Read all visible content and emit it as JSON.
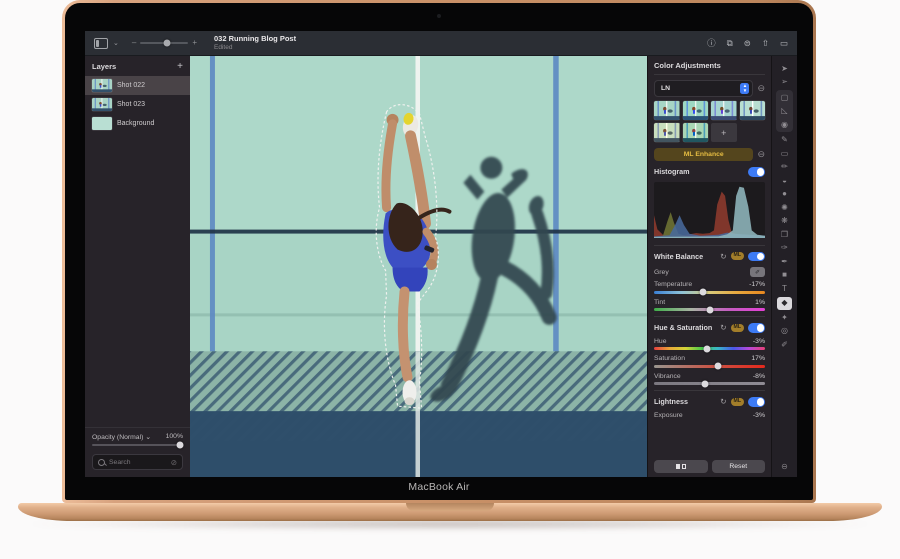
{
  "device": {
    "label": "MacBook Air"
  },
  "icons": {
    "chevron_down": "⌄",
    "reset": "↻",
    "remove": "⊖",
    "dropper": "✐",
    "stepper_up": "▲",
    "stepper_down": "▼",
    "search_clear": "⊘"
  },
  "toolbar": {
    "title": "032 Running Blog Post",
    "status": "Edited",
    "zoom": {
      "minus": "–",
      "plus": "+",
      "level": 55
    },
    "right_icons": [
      {
        "name": "info-icon",
        "glyph": "ⓘ"
      },
      {
        "name": "crop-icon",
        "glyph": "⧉"
      },
      {
        "name": "more-options-icon",
        "glyph": "⊜"
      },
      {
        "name": "share-icon",
        "glyph": "⇧"
      },
      {
        "name": "canvas-icon",
        "glyph": "▭"
      }
    ]
  },
  "layers_panel": {
    "title": "Layers",
    "add_label": "+",
    "items": [
      {
        "label": "Shot 022",
        "selected": true,
        "thumb": "photo"
      },
      {
        "label": "Shot 023",
        "selected": false,
        "thumb": "photo"
      },
      {
        "label": "Background",
        "selected": false,
        "thumb": "plain"
      }
    ],
    "opacity": {
      "label": "Opacity (Normal) ⌄",
      "value": "100%",
      "percent": 97
    },
    "search": {
      "placeholder": "Search"
    }
  },
  "adjustments_panel": {
    "title": "Color Adjustments",
    "preset_select": {
      "value": "LN"
    },
    "presets": {
      "add_label": "+",
      "variants": [
        "saturate(1.05)",
        "saturate(1.35)",
        "hue-rotate(18deg) saturate(1.1)",
        "contrast(1.15) saturate(.78)",
        "sepia(.35) saturate(1.15)",
        "hue-rotate(-25deg) saturate(1.2)"
      ]
    },
    "ml_enhance_label": "ML Enhance",
    "histogram": {
      "label": "Histogram",
      "enabled": true,
      "series": [
        {
          "color": "#8e3a2e",
          "heights": [
            [
              0,
              42
            ],
            [
              3,
              16
            ],
            [
              8,
              6
            ],
            [
              14,
              5
            ],
            [
              20,
              6
            ],
            [
              26,
              5
            ],
            [
              32,
              7
            ],
            [
              38,
              9
            ],
            [
              44,
              8
            ],
            [
              50,
              9
            ],
            [
              54,
              14
            ],
            [
              57,
              62
            ],
            [
              61,
              86
            ],
            [
              64,
              78
            ],
            [
              67,
              34
            ],
            [
              70,
              10
            ],
            [
              76,
              6
            ],
            [
              84,
              5
            ],
            [
              92,
              4
            ],
            [
              100,
              3
            ]
          ]
        },
        {
          "color": "#6f7434",
          "heights": [
            [
              0,
              2
            ],
            [
              8,
              4
            ],
            [
              12,
              30
            ],
            [
              15,
              48
            ],
            [
              18,
              28
            ],
            [
              22,
              8
            ],
            [
              30,
              3
            ],
            [
              60,
              2
            ],
            [
              100,
              2
            ]
          ]
        },
        {
          "color": "#48699b",
          "heights": [
            [
              0,
              3
            ],
            [
              14,
              5
            ],
            [
              19,
              24
            ],
            [
              23,
              42
            ],
            [
              27,
              24
            ],
            [
              32,
              8
            ],
            [
              42,
              4
            ],
            [
              58,
              6
            ],
            [
              66,
              10
            ],
            [
              72,
              8
            ],
            [
              100,
              4
            ]
          ]
        },
        {
          "color": "#8fb6bd",
          "heights": [
            [
              0,
              2
            ],
            [
              58,
              3
            ],
            [
              66,
              7
            ],
            [
              71,
              14
            ],
            [
              74,
              78
            ],
            [
              77,
              95
            ],
            [
              81,
              93
            ],
            [
              85,
              58
            ],
            [
              88,
              14
            ],
            [
              93,
              6
            ],
            [
              100,
              4
            ]
          ]
        }
      ]
    },
    "sections": [
      {
        "title": "White Balance",
        "ml": "ML",
        "toggle": true,
        "controls": [
          {
            "type": "eyedropper",
            "label": "Grey"
          },
          {
            "type": "slider",
            "label": "Temperature",
            "value": "-17%",
            "pos": 44,
            "gradient": "temperature"
          },
          {
            "type": "slider",
            "label": "Tint",
            "value": "1%",
            "pos": 50,
            "gradient": "tint"
          }
        ]
      },
      {
        "title": "Hue & Saturation",
        "ml": "ML",
        "toggle": true,
        "controls": [
          {
            "type": "slider",
            "label": "Hue",
            "value": "-3%",
            "pos": 48,
            "gradient": "hue"
          },
          {
            "type": "slider",
            "label": "Saturation",
            "value": "17%",
            "pos": 58,
            "gradient": "saturation"
          },
          {
            "type": "slider",
            "label": "Vibrance",
            "value": "-8%",
            "pos": 46,
            "gradient": "vibrance"
          }
        ]
      },
      {
        "title": "Lightness",
        "ml": "ML",
        "toggle": true,
        "controls": [
          {
            "type": "value-row",
            "label": "Exposure",
            "value": "-3%"
          }
        ]
      }
    ],
    "footer": {
      "reset_label": "Reset"
    }
  },
  "tool_strip": {
    "tools": [
      {
        "name": "arrange-tool",
        "glyph": "➤"
      },
      {
        "name": "pointer-tool",
        "glyph": "➢"
      },
      {
        "name": "marquee-select-tool",
        "glyph": "▢",
        "grouped": true
      },
      {
        "name": "lasso-select-tool",
        "glyph": "◺",
        "grouped": true
      },
      {
        "name": "quick-select-tool",
        "glyph": "◉",
        "grouped": true
      },
      {
        "name": "paint-tool",
        "glyph": "✎"
      },
      {
        "name": "erase-tool",
        "glyph": "▭"
      },
      {
        "name": "pencil-tool",
        "glyph": "✏"
      },
      {
        "name": "gradient-tool",
        "glyph": "◒"
      },
      {
        "name": "fill-tool",
        "glyph": "●"
      },
      {
        "name": "sharpen-tool",
        "glyph": "✺"
      },
      {
        "name": "retouch-tool",
        "glyph": "❋"
      },
      {
        "name": "clone-tool",
        "glyph": "❐"
      },
      {
        "name": "smudge-tool",
        "glyph": "✑"
      },
      {
        "name": "pen-tool",
        "glyph": "✒"
      },
      {
        "name": "shape-tool",
        "glyph": "■"
      },
      {
        "name": "type-tool",
        "glyph": "T"
      },
      {
        "name": "color-adjustments-tool",
        "glyph": "◆",
        "active": true
      },
      {
        "name": "effects-tool",
        "glyph": "✦"
      },
      {
        "name": "zoom-tool",
        "glyph": "◎"
      },
      {
        "name": "color-picker-tool",
        "glyph": "✐"
      }
    ],
    "remove_tool": {
      "name": "remove-tool-icon",
      "glyph": "⊖"
    }
  }
}
